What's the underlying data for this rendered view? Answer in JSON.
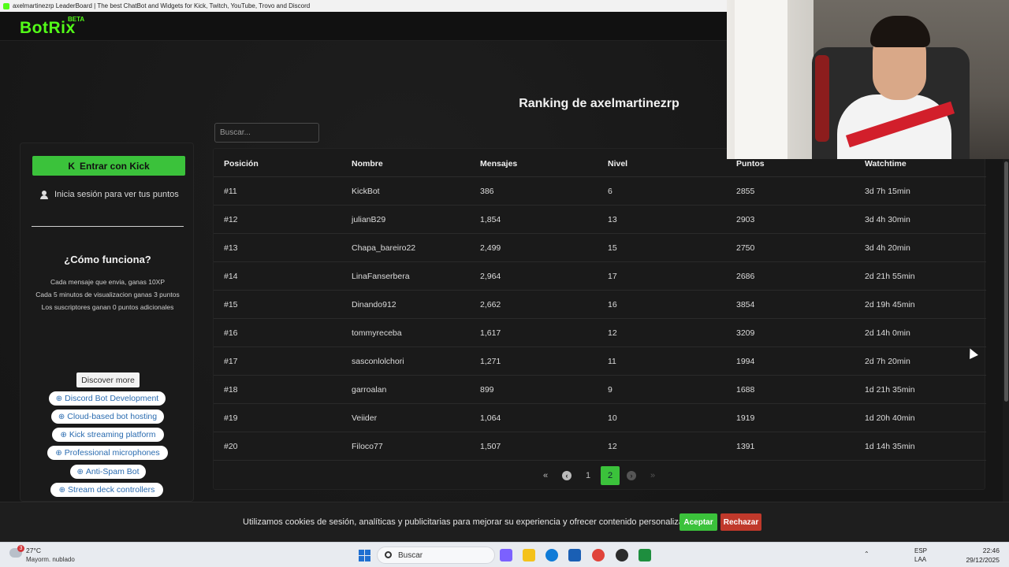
{
  "browser": {
    "title": "axelmartinezrp LeaderBoard | The best ChatBot and Widgets for Kick, Twitch, YouTube, Trovo and Discord"
  },
  "header": {
    "logo": "BotRix",
    "badge": "BETA"
  },
  "page": {
    "title": "Ranking de axelmartinezrp"
  },
  "search": {
    "placeholder": "Buscar..."
  },
  "sidebar": {
    "login_button": "Entrar con Kick",
    "login_hint": "Inicia sesión para ver tus puntos",
    "how_title": "¿Cómo funciona?",
    "how_lines": [
      "Cada mensaje que envia, ganas 10XP",
      "Cada 5 minutos de visualizacion ganas 3 puntos",
      "Los suscriptores ganan 0 puntos adicionales"
    ],
    "discover": "Discover more",
    "links": [
      "Discord Bot Development",
      "Cloud-based bot hosting",
      "Kick streaming platform",
      "Professional microphones",
      "Anti-Spam Bot",
      "Stream deck controllers"
    ]
  },
  "table": {
    "headers": [
      "Posición",
      "Nombre",
      "Mensajes",
      "Nivel",
      "Puntos",
      "Watchtime"
    ],
    "rows": [
      [
        "#11",
        "KickBot",
        "386",
        "6",
        "2855",
        "3d 7h 15min"
      ],
      [
        "#12",
        "julianB29",
        "1,854",
        "13",
        "2903",
        "3d 4h 30min"
      ],
      [
        "#13",
        "Chapa_bareiro22",
        "2,499",
        "15",
        "2750",
        "3d 4h 20min"
      ],
      [
        "#14",
        "LinaFanserbera",
        "2,964",
        "17",
        "2686",
        "2d 21h 55min"
      ],
      [
        "#15",
        "Dinando912",
        "2,662",
        "16",
        "3854",
        "2d 19h 45min"
      ],
      [
        "#16",
        "tommyreceba",
        "1,617",
        "12",
        "3209",
        "2d 14h 0min"
      ],
      [
        "#17",
        "sasconlolchori",
        "1,271",
        "11",
        "1994",
        "2d 7h 20min"
      ],
      [
        "#18",
        "garroalan",
        "899",
        "9",
        "1688",
        "1d 21h 35min"
      ],
      [
        "#19",
        "Veiider",
        "1,064",
        "10",
        "1919",
        "1d 20h 40min"
      ],
      [
        "#20",
        "Filoco77",
        "1,507",
        "12",
        "1391",
        "1d 14h 35min"
      ]
    ]
  },
  "pager": {
    "first": "«",
    "prev": "‹",
    "pages": [
      "1",
      "2"
    ],
    "current": "2",
    "next": "›",
    "last": "»"
  },
  "cookie": {
    "text": "Utilizamos cookies de sesión, analíticas y publicitarias para mejorar su experiencia y ofrecer contenido personalizado.",
    "accept": "Aceptar",
    "reject": "Rechazar"
  },
  "taskbar": {
    "weather_badge": "3",
    "temp": "27°C",
    "weather": "Mayorm. nublado",
    "search": "Buscar",
    "lang_top": "ESP",
    "lang_bottom": "LAA",
    "time": "22:46",
    "date": "29/12/2025"
  },
  "colors": {
    "accent": "#53fc18",
    "button_green": "#3bc23b",
    "reject_red": "#c0392b",
    "link_blue": "#2b6cb0"
  },
  "icons": [
    "kick-icon",
    "user-icon",
    "plus-circle-icon",
    "double-chevron-left-icon",
    "chevron-left-icon",
    "chevron-right-icon",
    "double-chevron-right-icon",
    "windows-icon",
    "search-icon"
  ]
}
